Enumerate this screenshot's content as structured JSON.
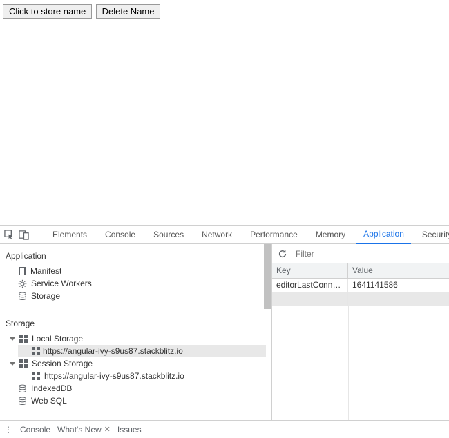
{
  "app": {
    "buttons": {
      "store": "Click to store name",
      "delete": "Delete Name"
    }
  },
  "devtools": {
    "tabs": [
      "Elements",
      "Console",
      "Sources",
      "Network",
      "Performance",
      "Memory",
      "Application",
      "Security"
    ],
    "activeTab": "Application",
    "sidebar": {
      "sections": {
        "application": {
          "title": "Application",
          "items": [
            {
              "label": "Manifest",
              "icon": "manifest-icon"
            },
            {
              "label": "Service Workers",
              "icon": "gear-icon"
            },
            {
              "label": "Storage",
              "icon": "database-icon"
            }
          ]
        },
        "storage": {
          "title": "Storage",
          "items": [
            {
              "label": "Local Storage",
              "icon": "grid-icon",
              "expanded": true,
              "children": [
                {
                  "label": "https://angular-ivy-s9us87.stackblitz.io",
                  "icon": "grid-icon",
                  "selected": true
                }
              ]
            },
            {
              "label": "Session Storage",
              "icon": "grid-icon",
              "expanded": true,
              "children": [
                {
                  "label": "https://angular-ivy-s9us87.stackblitz.io",
                  "icon": "grid-icon"
                }
              ]
            },
            {
              "label": "IndexedDB",
              "icon": "database-icon"
            },
            {
              "label": "Web SQL",
              "icon": "database-icon"
            }
          ]
        }
      }
    },
    "main": {
      "filterPlaceholder": "Filter",
      "columns": {
        "key": "Key",
        "value": "Value"
      },
      "rows": [
        {
          "key": "editorLastConnec...",
          "value": "1641141586"
        }
      ]
    },
    "drawer": {
      "tabs": [
        {
          "label": "Console"
        },
        {
          "label": "What's New",
          "closable": true
        },
        {
          "label": "Issues"
        }
      ]
    }
  }
}
